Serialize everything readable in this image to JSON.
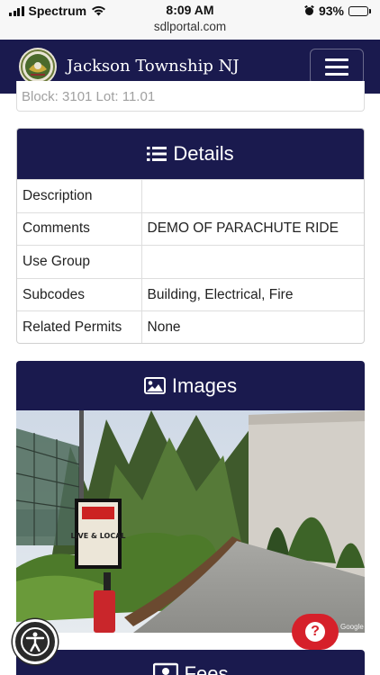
{
  "status_bar": {
    "carrier": "Spectrum",
    "time": "8:09 AM",
    "url": "sdlportal.com",
    "battery": "93%",
    "battery_level": 0.93
  },
  "navbar": {
    "brand": "Jackson Township NJ",
    "menu_icon": "hamburger-icon",
    "seal_icon": "township-seal-icon"
  },
  "top_card": {
    "text": "Block: 3101 Lot: 11.01"
  },
  "details": {
    "title": "Details",
    "icon": "list-icon",
    "rows": [
      {
        "label": "Description",
        "value": ""
      },
      {
        "label": "Comments",
        "value": "DEMO OF PARACHUTE RIDE"
      },
      {
        "label": "Use Group",
        "value": ""
      },
      {
        "label": "Subcodes",
        "value": "Building, Electrical, Fire"
      },
      {
        "label": "Related Permits",
        "value": "None"
      }
    ]
  },
  "images": {
    "title": "Images",
    "icon": "image-icon",
    "photo_sign_text": "LIVE & LOCAL",
    "photo_watermark": "Google"
  },
  "fees": {
    "title": "Fees",
    "icon": "money-icon"
  },
  "floating": {
    "accessibility_icon": "accessibility-icon",
    "help_icon": "question-mark-icon",
    "help_glyph": "?"
  },
  "colors": {
    "navy": "#1a1a4e",
    "help_red": "#d6202a",
    "battery_green": "#2ecc40"
  }
}
